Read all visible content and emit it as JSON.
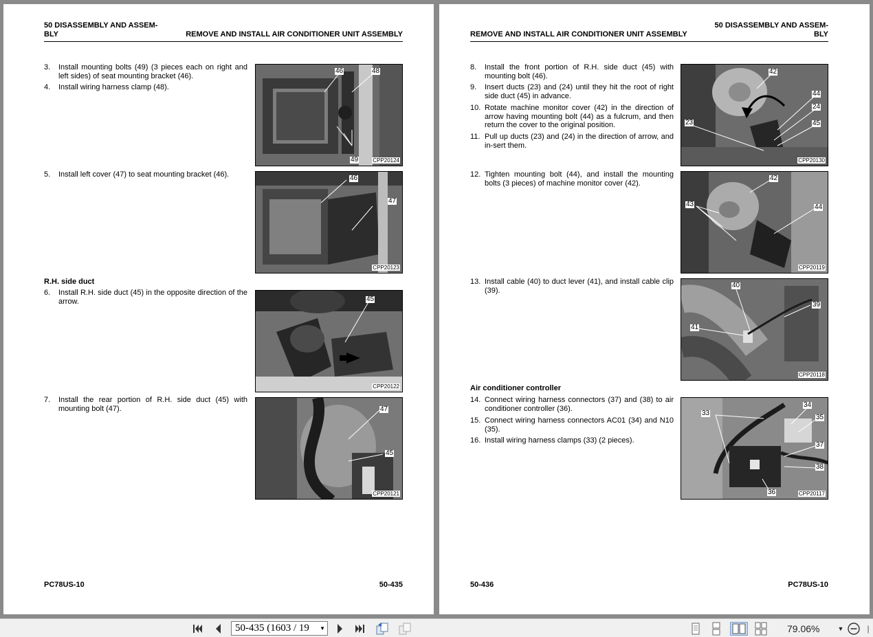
{
  "left_page": {
    "header_section": "50 DISASSEMBLY AND ASSEM-\nBLY",
    "header_title": "REMOVE AND INSTALL AIR CONDITIONER UNIT ASSEMBLY",
    "steps": [
      {
        "num": "3.",
        "text": "Install mounting bolts (49) (3 pieces each on right and left sides) of seat mounting bracket (46)."
      },
      {
        "num": "4.",
        "text": "Install wiring harness clamp (48)."
      },
      {
        "num": "5.",
        "text": "Install left cover (47) to seat mounting bracket (46)."
      },
      {
        "num": "6.",
        "text": "Install R.H. side duct (45) in the opposite direction of the arrow."
      },
      {
        "num": "7.",
        "text": "Install the rear portion of R.H. side duct (45) with mounting bolt (47)."
      }
    ],
    "section_rh_duct": "R.H. side duct",
    "figures": [
      {
        "code": "CPP20124",
        "callouts": [
          "46",
          "48",
          "49"
        ]
      },
      {
        "code": "CPP20123",
        "callouts": [
          "46",
          "47"
        ]
      },
      {
        "code": "CPP20122",
        "callouts": [
          "45"
        ]
      },
      {
        "code": "CPP20121",
        "callouts": [
          "47",
          "45"
        ]
      }
    ],
    "footer_model": "PC78US-10",
    "footer_page": "50-435"
  },
  "right_page": {
    "header_section": "50 DISASSEMBLY AND ASSEM-\nBLY",
    "header_title": "REMOVE AND INSTALL AIR CONDITIONER UNIT ASSEMBLY",
    "steps": [
      {
        "num": "8.",
        "text": "Install the front portion of R.H. side duct (45) with mounting bolt (46)."
      },
      {
        "num": "9.",
        "text": "Insert ducts (23) and (24) until they hit the root of right side duct (45) in advance."
      },
      {
        "num": "10.",
        "text": "Rotate machine monitor cover (42) in the direction of arrow having mounting bolt (44) as a fulcrum, and then return the cover to the original position."
      },
      {
        "num": "11.",
        "text": "Pull up ducts (23) and (24) in the direction of arrow, and in-sert them."
      },
      {
        "num": "12.",
        "text": "Tighten mounting bolt (44), and install the mounting bolts (3 pieces) of machine monitor cover (42)."
      },
      {
        "num": "13.",
        "text": "Install cable (40) to duct lever (41), and install cable clip (39)."
      },
      {
        "num": "14.",
        "text": "Connect wiring harness connectors (37) and (38) to air conditioner controller (36)."
      },
      {
        "num": "15.",
        "text": "Connect wiring harness connectors AC01 (34) and N10 (35)."
      },
      {
        "num": "16.",
        "text": "Install wiring harness clamps (33) (2 pieces)."
      }
    ],
    "section_ac_controller": "Air conditioner controller",
    "figures": [
      {
        "code": "CPP20130",
        "callouts": [
          "42",
          "44",
          "24",
          "45",
          "23"
        ]
      },
      {
        "code": "CPP20119",
        "callouts": [
          "42",
          "43",
          "44"
        ]
      },
      {
        "code": "CPP20118",
        "callouts": [
          "40",
          "39",
          "41"
        ]
      },
      {
        "code": "CPP20117",
        "callouts": [
          "34",
          "33",
          "35",
          "37",
          "38",
          "36"
        ]
      }
    ],
    "footer_page": "50-436",
    "footer_model": "PC78US-10"
  },
  "toolbar": {
    "page_value": "50-435 (1603 / 19",
    "zoom": "79.06%",
    "icons": [
      "first-page-icon",
      "prev-page-icon",
      "next-page-icon",
      "last-page-icon",
      "previous-view-icon",
      "next-view-icon",
      "single-page-icon",
      "continuous-icon",
      "facing-icon",
      "continuous-facing-icon",
      "zoom-out-icon"
    ]
  }
}
